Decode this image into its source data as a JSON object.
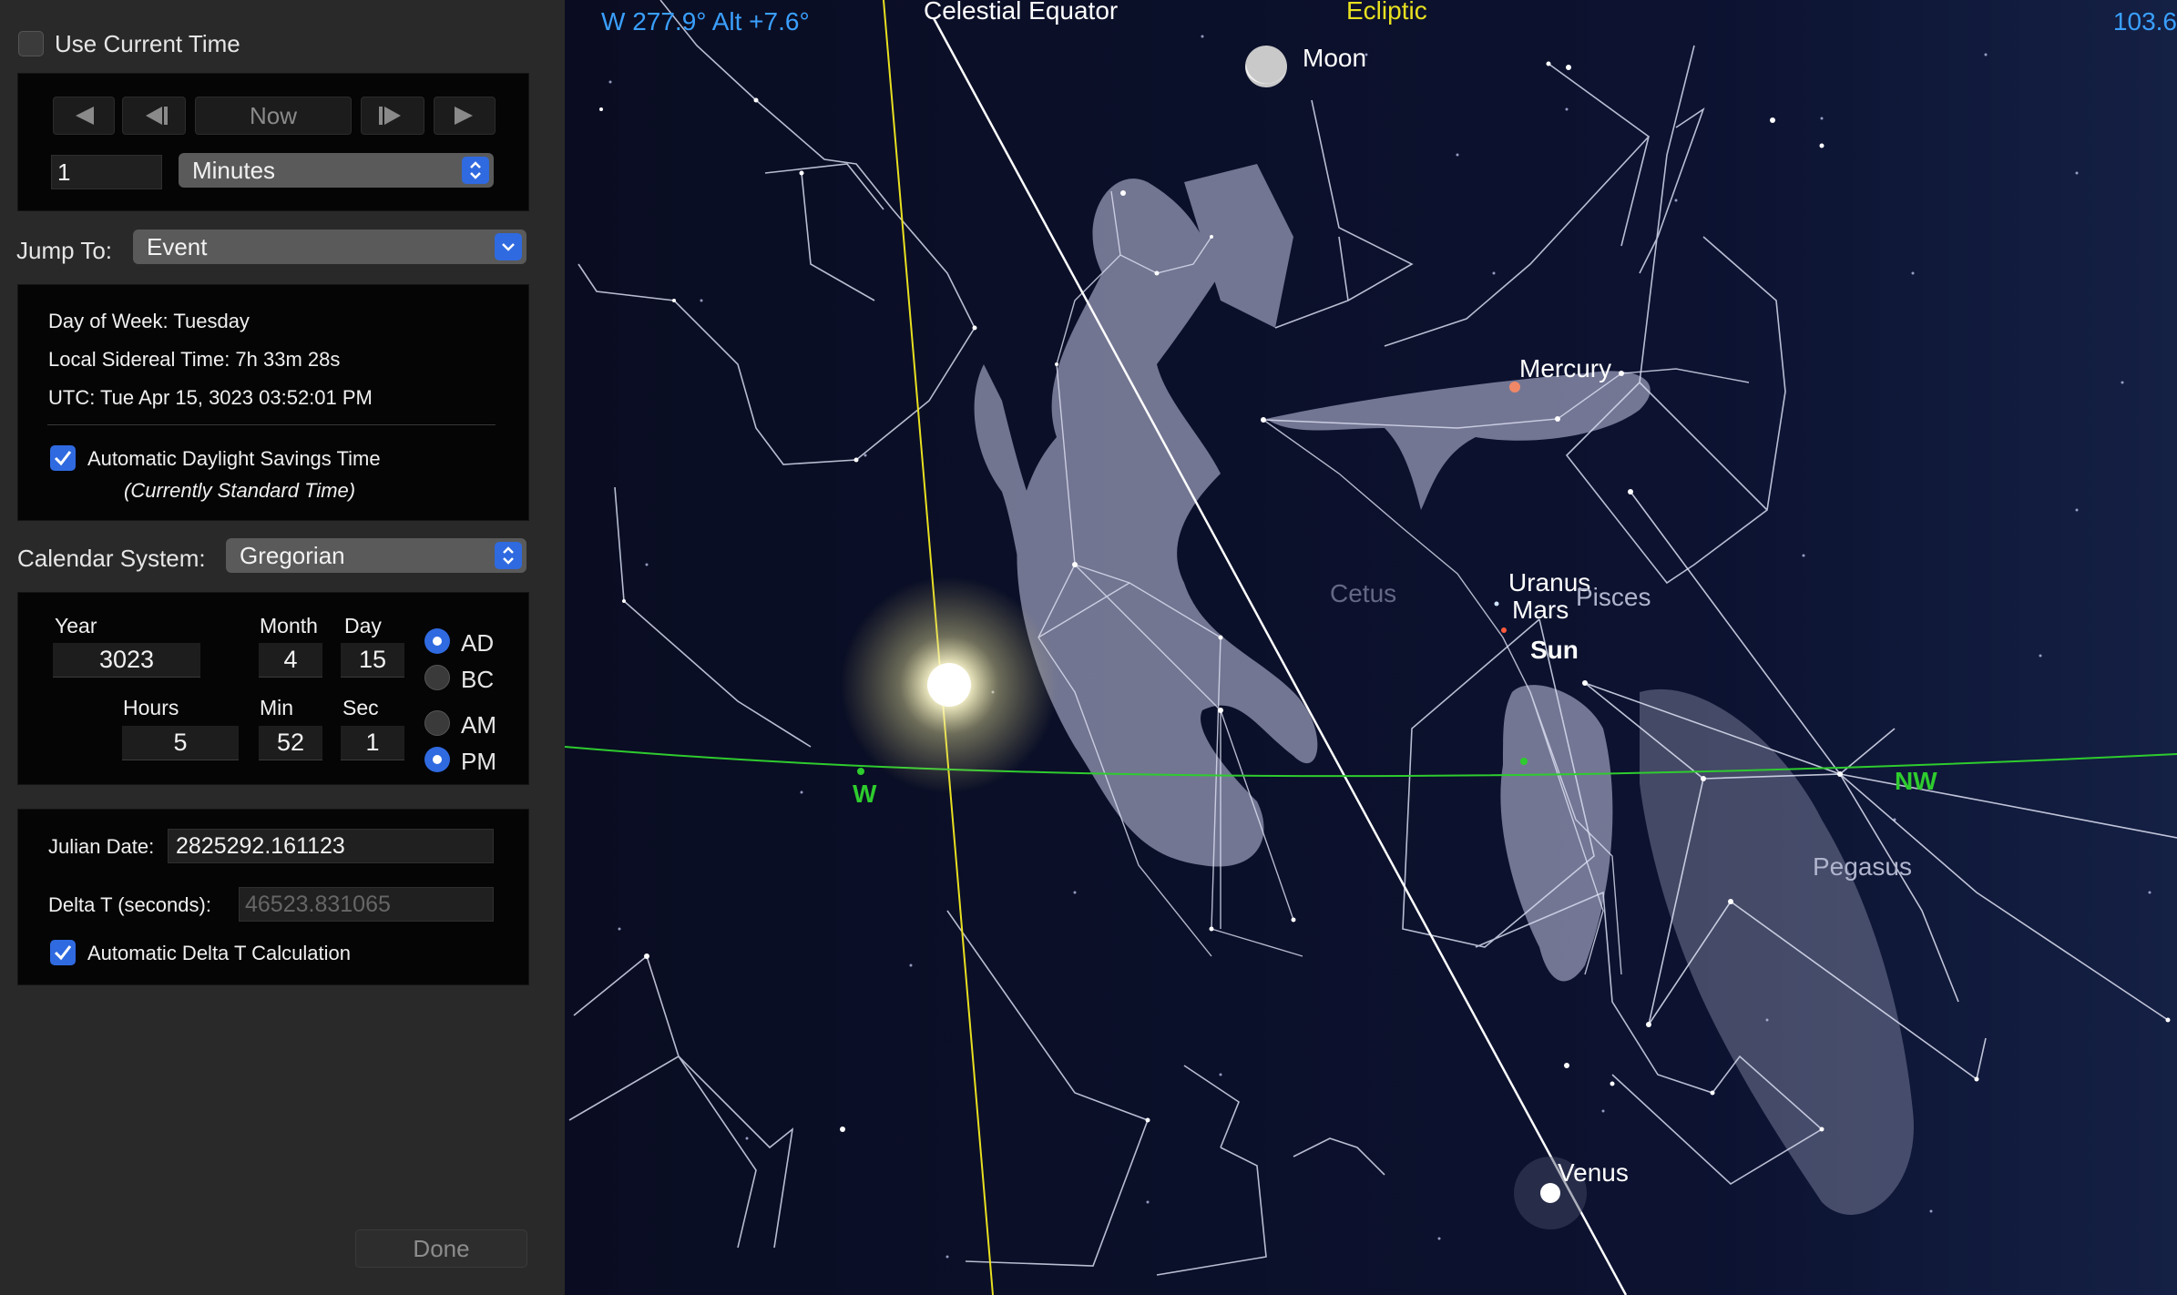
{
  "panel": {
    "use_current_time": {
      "label": "Use Current Time",
      "checked": false
    },
    "nav": {
      "now_label": "Now",
      "step_value": "1",
      "step_unit": "Minutes",
      "buttons": [
        "rewind-icon",
        "step-back-icon",
        "step-forward-icon",
        "play-icon"
      ]
    },
    "jump_to": {
      "label": "Jump To:",
      "value": "Event"
    },
    "info": {
      "day_of_week": "Day of Week:  Tuesday",
      "sidereal": "Local Sidereal Time:  7h 33m 28s",
      "utc": "UTC:  Tue Apr 15, 3023  03:52:01 PM",
      "dst_label": "Automatic Daylight Savings Time",
      "dst_note": "(Currently Standard Time)",
      "dst_checked": true
    },
    "calendar": {
      "label": "Calendar System:",
      "value": "Gregorian"
    },
    "date": {
      "year_label": "Year",
      "year": "3023",
      "month_label": "Month",
      "month": "4",
      "day_label": "Day",
      "day": "15",
      "hours_label": "Hours",
      "hours": "5",
      "min_label": "Min",
      "min": "52",
      "sec_label": "Sec",
      "sec": "1",
      "era": {
        "ad": "AD",
        "bc": "BC",
        "selected": "AD"
      },
      "meridiem": {
        "am": "AM",
        "pm": "PM",
        "selected": "PM"
      }
    },
    "julian": {
      "julian_label": "Julian Date:",
      "julian_value": "2825292.161123",
      "delta_label": "Delta T (seconds):",
      "delta_value": "46523.831065",
      "auto_delta_label": "Automatic Delta T Calculation",
      "auto_delta_checked": true
    },
    "done_label": "Done"
  },
  "sky": {
    "coords": "W 277.9° Alt +7.6°",
    "fov": "103.6",
    "lines": {
      "celestial_equator": "Celestial Equator",
      "ecliptic": "Ecliptic"
    },
    "bodies": {
      "moon": "Moon",
      "mercury": "Mercury",
      "uranus": "Uranus",
      "mars": "Mars",
      "sun": "Sun",
      "venus": "Venus"
    },
    "constellations": {
      "cetus": "Cetus",
      "pisces": "Pisces",
      "pegasus": "Pegasus"
    },
    "horizon": {
      "w": "W",
      "nw": "NW"
    },
    "colors": {
      "background": "#0a0d22",
      "ecliptic": "#e8e020",
      "horizon": "#2ecc2e",
      "coords": "#3aa0ff"
    }
  }
}
